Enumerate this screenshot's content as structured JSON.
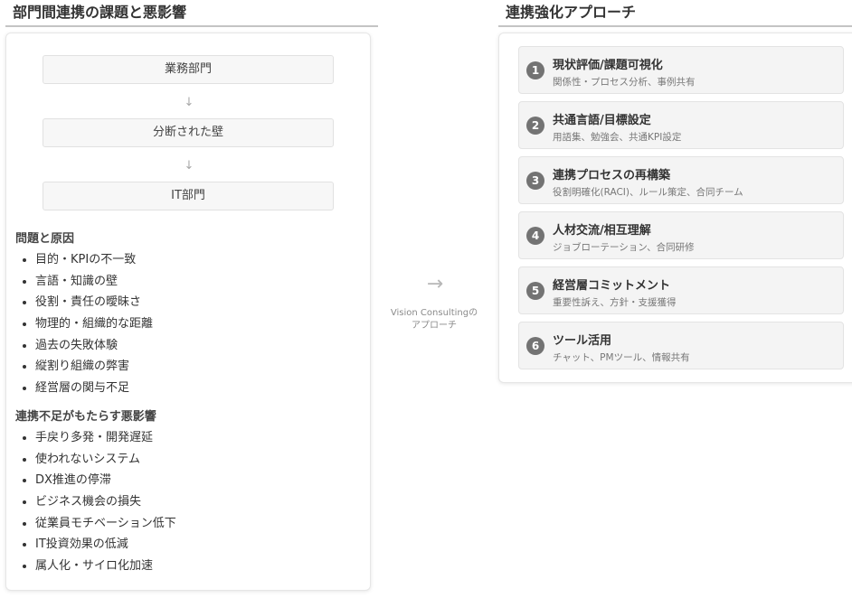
{
  "left": {
    "title": "部門間連携の課題と悪影響",
    "flow": [
      "業務部門",
      "分断された壁",
      "IT部門"
    ],
    "arrow_glyph": "↓",
    "problems": {
      "heading": "問題と原因",
      "items": [
        "目的・KPIの不一致",
        "言語・知識の壁",
        "役割・責任の曖昧さ",
        "物理的・組織的な距離",
        "過去の失敗体験",
        "縦割り組織の弊害",
        "経営層の関与不足"
      ]
    },
    "effects": {
      "heading": "連携不足がもたらす悪影響",
      "items": [
        "手戻り多発・開発遅延",
        "使われないシステム",
        "DX推進の停滞",
        "ビジネス機会の損失",
        "従業員モチベーション低下",
        "IT投資効果の低減",
        "属人化・サイロ化加速"
      ]
    }
  },
  "center": {
    "arrow_glyph": "→",
    "caption_line1": "Vision Consultingの",
    "caption_line2": "アプローチ"
  },
  "right": {
    "title": "連携強化アプローチ",
    "steps": [
      {
        "num": "1",
        "title": "現状評価/課題可視化",
        "desc": "関係性・プロセス分析、事例共有"
      },
      {
        "num": "2",
        "title": "共通言語/目標設定",
        "desc": "用語集、勉強会、共通KPI設定"
      },
      {
        "num": "3",
        "title": "連携プロセスの再構築",
        "desc": "役割明確化(RACI)、ルール策定、合同チーム"
      },
      {
        "num": "4",
        "title": "人材交流/相互理解",
        "desc": "ジョブローテーション、合同研修"
      },
      {
        "num": "5",
        "title": "経営層コミットメント",
        "desc": "重要性訴え、方針・支援獲得"
      },
      {
        "num": "6",
        "title": "ツール活用",
        "desc": "チャット、PMツール、情報共有"
      }
    ]
  }
}
